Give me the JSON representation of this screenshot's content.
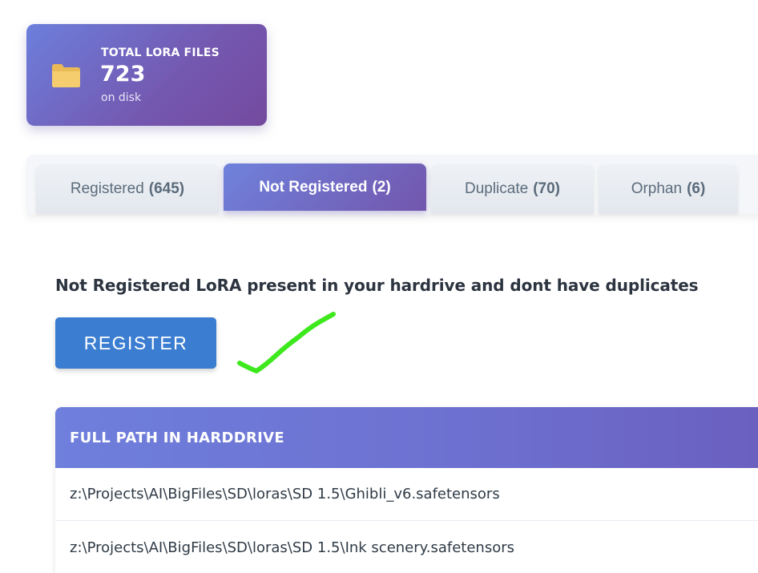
{
  "stats": {
    "label": "TOTAL LORA FILES",
    "value": "723",
    "sub": "on disk",
    "icon": "folder-icon"
  },
  "tabs": [
    {
      "label": "Registered",
      "count": "(645)",
      "active": false
    },
    {
      "label": "Not Registered",
      "count": "(2)",
      "active": true
    },
    {
      "label": "Duplicate",
      "count": "(70)",
      "active": false
    },
    {
      "label": "Orphan",
      "count": "(6)",
      "active": false
    }
  ],
  "content": {
    "heading": "Not Registered LoRA present in your hardrive and dont have duplicates",
    "register_label": "REGISTER"
  },
  "table": {
    "header": "FULL PATH IN HARDDRIVE",
    "rows": [
      "z:\\Projects\\AI\\BigFiles\\SD\\loras\\SD 1.5\\Ghibli_v6.safetensors",
      "z:\\Projects\\AI\\BigFiles\\SD\\loras\\SD 1.5\\Ink scenery.safetensors"
    ]
  },
  "colors": {
    "accent_gradient_start": "#6f82dc",
    "accent_gradient_end": "#7356ad",
    "button": "#3b7dd1",
    "annotation_check": "#3de81c"
  }
}
